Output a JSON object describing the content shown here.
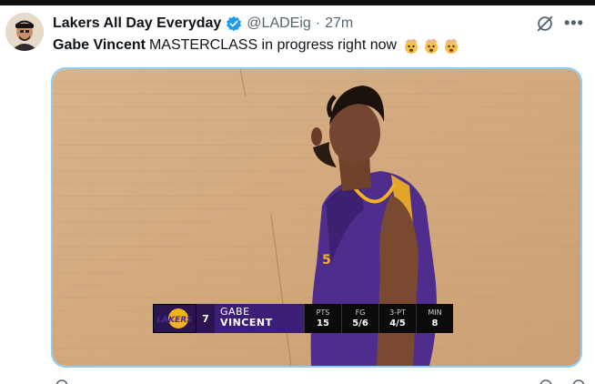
{
  "tweet": {
    "author_name": "Lakers All Day Everyday",
    "handle": "@LADEig",
    "separator": "·",
    "time": "27m",
    "text_bold": "Gabe Vincent",
    "text_rest": "MASTERCLASS in progress right now",
    "emoji_count": 3,
    "icons": [
      "verified-badge-icon",
      "grok-icon",
      "more-icon",
      "exploding-head-emoji"
    ]
  },
  "media": {
    "scorebug": {
      "team_logo_text": "LAKERS",
      "jersey_number": "7",
      "first_name": "GABE",
      "last_name": "VINCENT",
      "stats": [
        {
          "label": "PTS",
          "value": "15"
        },
        {
          "label": "FG",
          "value": "5/6"
        },
        {
          "label": "3-PT",
          "value": "4/5"
        },
        {
          "label": "MIN",
          "value": "8"
        }
      ]
    }
  },
  "colors": {
    "accent": "#1d9bf0",
    "lakers_purple": "#3b1f77",
    "lakers_gold": "#f5b521"
  }
}
